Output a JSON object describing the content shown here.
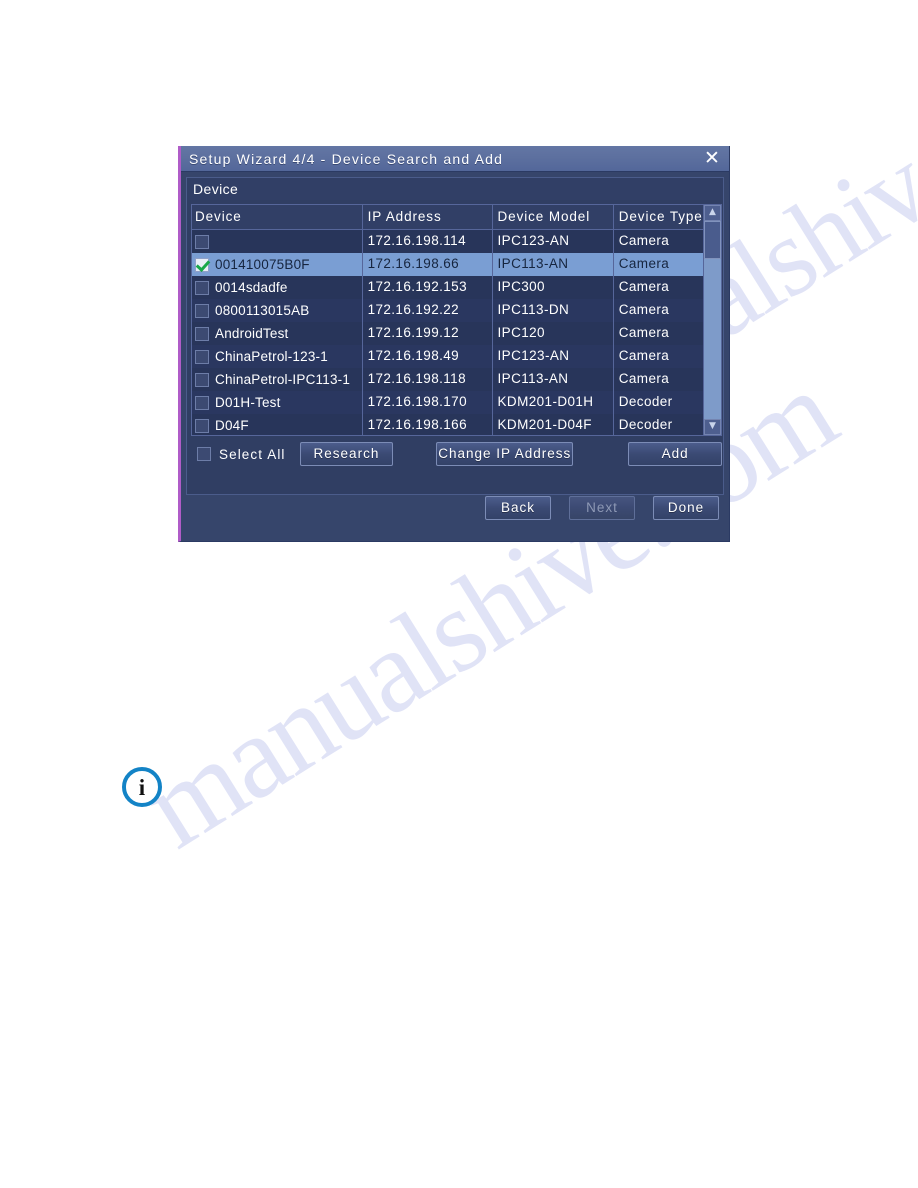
{
  "watermark": {
    "text": "manualshive.com"
  },
  "dialog": {
    "title": "Setup Wizard 4/4 - Device Search and Add",
    "close_icon": "close-icon",
    "group_label": "Device",
    "accent_color": "#b05cc8",
    "titlebar_color": "#5d709f",
    "selected_row_color": "#7a9ed3",
    "check_color": "#19a84a"
  },
  "table": {
    "columns": [
      "Device",
      "IP Address",
      "Device Model",
      "Device Type"
    ],
    "rows": [
      {
        "checked": false,
        "selected": false,
        "device": "",
        "ip": "172.16.198.114",
        "model": "IPC123-AN",
        "type": "Camera"
      },
      {
        "checked": true,
        "selected": true,
        "device": "001410075B0F",
        "ip": "172.16.198.66",
        "model": "IPC113-AN",
        "type": "Camera"
      },
      {
        "checked": false,
        "selected": false,
        "device": "0014sdadfe",
        "ip": "172.16.192.153",
        "model": "IPC300",
        "type": "Camera"
      },
      {
        "checked": false,
        "selected": false,
        "device": "0800113015AB",
        "ip": "172.16.192.22",
        "model": "IPC113-DN",
        "type": "Camera"
      },
      {
        "checked": false,
        "selected": false,
        "device": "AndroidTest",
        "ip": "172.16.199.12",
        "model": "IPC120",
        "type": "Camera"
      },
      {
        "checked": false,
        "selected": false,
        "device": "ChinaPetrol-123-1",
        "ip": "172.16.198.49",
        "model": "IPC123-AN",
        "type": "Camera"
      },
      {
        "checked": false,
        "selected": false,
        "device": "ChinaPetrol-IPC113-1",
        "ip": "172.16.198.118",
        "model": "IPC113-AN",
        "type": "Camera"
      },
      {
        "checked": false,
        "selected": false,
        "device": "D01H-Test",
        "ip": "172.16.198.170",
        "model": "KDM201-D01H",
        "type": "Decoder"
      },
      {
        "checked": false,
        "selected": false,
        "device": "D04F",
        "ip": "172.16.198.166",
        "model": "KDM201-D04F",
        "type": "Decoder"
      }
    ],
    "scrollbar": {
      "up_icon": "chevron-up-icon",
      "down_icon": "chevron-down-icon"
    }
  },
  "actions": {
    "select_all_checked": false,
    "select_all_label": "Select All",
    "research_label": "Research",
    "change_ip_label": "Change IP Address",
    "add_label": "Add"
  },
  "footer": {
    "back_label": "Back",
    "next_label": "Next",
    "next_disabled": true,
    "done_label": "Done"
  },
  "note": {
    "info_icon": "info-icon",
    "glyph": "i"
  }
}
